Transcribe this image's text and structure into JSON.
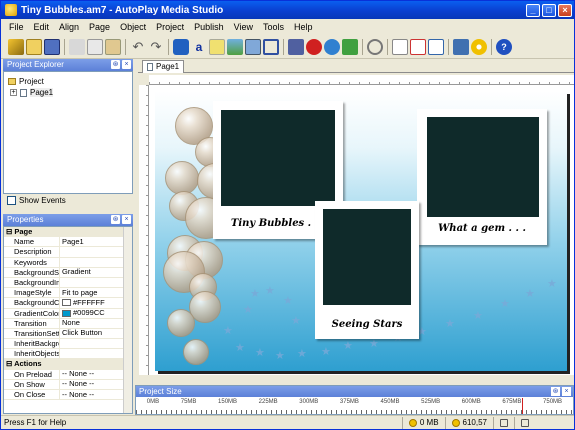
{
  "window": {
    "title": "Tiny Bubbles.am7 - AutoPlay Media Studio"
  },
  "menu": [
    "File",
    "Edit",
    "Align",
    "Page",
    "Object",
    "Project",
    "Publish",
    "View",
    "Tools",
    "Help"
  ],
  "toolbar_icons": [
    "wand-icon",
    "open-icon",
    "save-icon",
    "cut-icon",
    "copy-icon",
    "paste-icon",
    "undo-icon",
    "redo-icon",
    "button-object-icon",
    "text-object-icon",
    "paragraph-object-icon",
    "image-object-icon",
    "slideshow-object-icon",
    "frame-object-icon",
    "video-object-icon",
    "flash-object-icon",
    "web-object-icon",
    "tree-object-icon",
    "zoom-icon",
    "add-page-icon",
    "delete-page-icon",
    "preview-page-icon",
    "build-icon",
    "cd-icon",
    "help-icon"
  ],
  "explorer": {
    "title": "Project Explorer",
    "root": "Project",
    "page": "Page1",
    "show_events": "Show Events"
  },
  "properties": {
    "title": "Properties",
    "rows": [
      {
        "k": "Page",
        "v": "",
        "section": true
      },
      {
        "k": "Name",
        "v": "Page1"
      },
      {
        "k": "Description",
        "v": ""
      },
      {
        "k": "Keywords",
        "v": ""
      },
      {
        "k": "BackgroundStyle",
        "v": "Gradient"
      },
      {
        "k": "BackgroundImage",
        "v": ""
      },
      {
        "k": "ImageStyle",
        "v": "Fit to page"
      },
      {
        "k": "BackgroundColor",
        "v": "#FFFFFF",
        "swatch": "#FFFFFF"
      },
      {
        "k": "GradientColor",
        "v": "#0099CC",
        "swatch": "#0099CC"
      },
      {
        "k": "Transition",
        "v": "None"
      },
      {
        "k": "TransitionSettings",
        "v": "Click Button"
      },
      {
        "k": "InheritBackground",
        "v": ""
      },
      {
        "k": "InheritObjects",
        "v": ""
      },
      {
        "k": "Actions",
        "v": "",
        "section": true
      },
      {
        "k": "On Preload",
        "v": "-- None --"
      },
      {
        "k": "On Show",
        "v": "-- None --"
      },
      {
        "k": "On Close",
        "v": "-- None --"
      }
    ]
  },
  "tab": {
    "label": "Page1"
  },
  "captions": {
    "p1": "Tiny Bubbles . . .",
    "p2": "What a gem . . .",
    "p3": "Seeing Stars"
  },
  "project_size": {
    "title": "Project Size",
    "labels": [
      "0MB",
      "75MB",
      "150MB",
      "225MB",
      "300MB",
      "375MB",
      "450MB",
      "525MB",
      "600MB",
      "675MB",
      "750MB"
    ]
  },
  "status": {
    "help": "Press F1 for Help",
    "size": "0 MB",
    "coords": "610,57"
  },
  "colors": {
    "background_color": "#FFFFFF",
    "gradient_color": "#0099CC"
  }
}
